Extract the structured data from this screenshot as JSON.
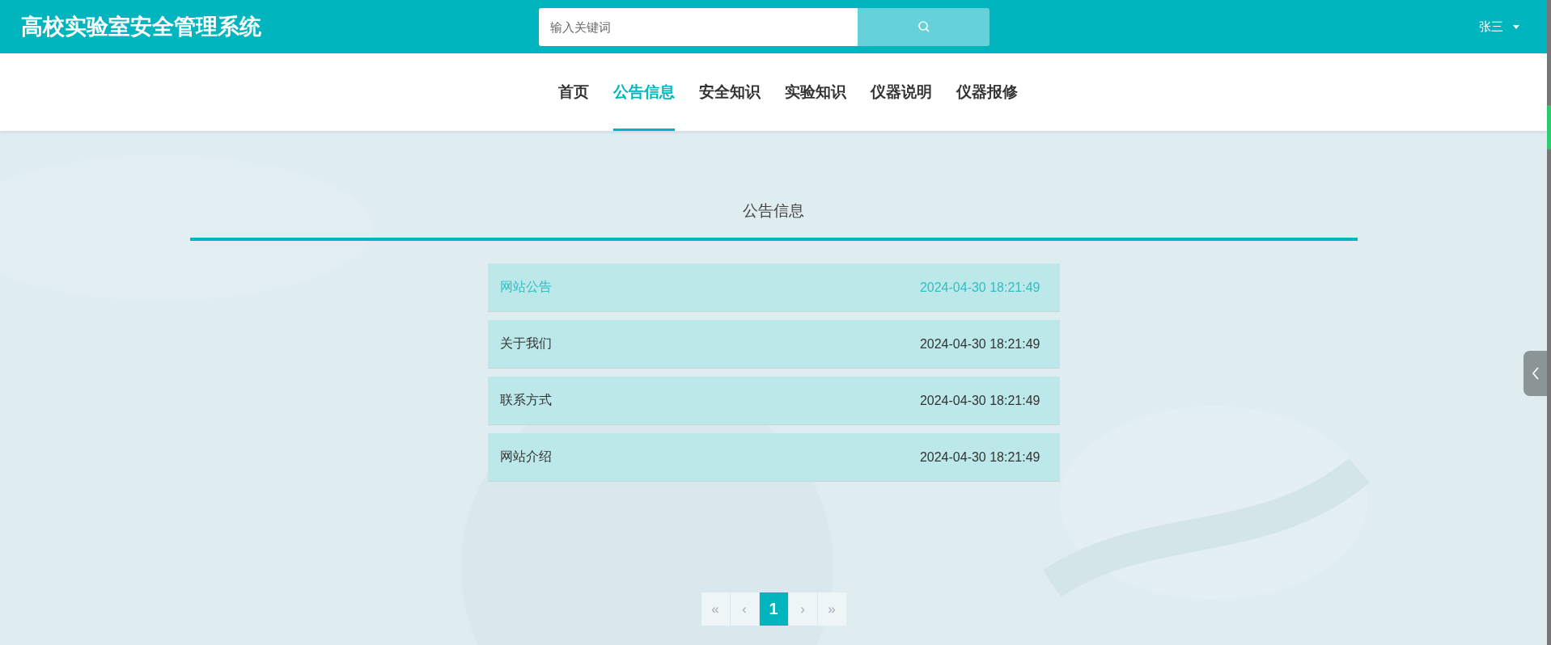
{
  "header": {
    "title": "高校实验室安全管理系统",
    "search": {
      "placeholder": "输入关键词"
    },
    "user": {
      "name": "张三"
    }
  },
  "nav": [
    {
      "label": "首页",
      "selected": false
    },
    {
      "label": "公告信息",
      "selected": true
    },
    {
      "label": "安全知识",
      "selected": false
    },
    {
      "label": "实验知识",
      "selected": false
    },
    {
      "label": "仪器说明",
      "selected": false
    },
    {
      "label": "仪器报修",
      "selected": false
    }
  ],
  "section": {
    "title": "公告信息"
  },
  "notices": [
    {
      "title": "网站公告",
      "time": "2024-04-30 18:21:49",
      "selected": true
    },
    {
      "title": "关于我们",
      "time": "2024-04-30 18:21:49",
      "selected": false
    },
    {
      "title": "联系方式",
      "time": "2024-04-30 18:21:49",
      "selected": false
    },
    {
      "title": "网站介绍",
      "time": "2024-04-30 18:21:49",
      "selected": false
    }
  ],
  "pagination": [
    {
      "label": "«",
      "selected": false
    },
    {
      "label": "‹",
      "selected": false
    },
    {
      "label": "1",
      "selected": true
    },
    {
      "label": "›",
      "selected": false
    },
    {
      "label": "»",
      "selected": false
    }
  ]
}
